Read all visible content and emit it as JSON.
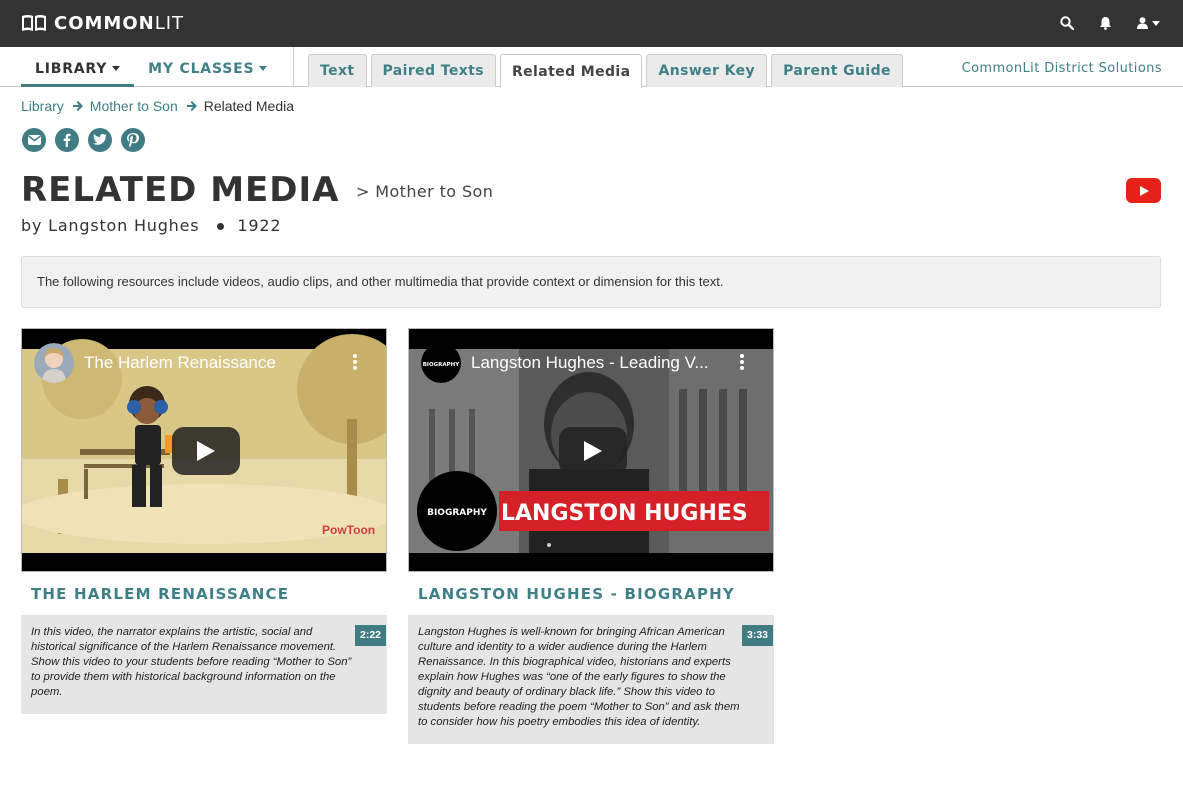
{
  "brand": {
    "name_bold": "COMMON",
    "name_light": "LIT"
  },
  "topbar": {
    "icons": [
      "search-icon",
      "bell-icon",
      "user-icon"
    ]
  },
  "nav": {
    "library": "LIBRARY",
    "my_classes": "MY CLASSES",
    "tabs": [
      "Text",
      "Paired Texts",
      "Related Media",
      "Answer Key",
      "Parent Guide"
    ],
    "active_tab": "Related Media",
    "district": "CommonLit District Solutions"
  },
  "breadcrumb": {
    "items": [
      "Library",
      "Mother to Son",
      "Related Media"
    ]
  },
  "share": {
    "icons": [
      "email-icon",
      "facebook-icon",
      "twitter-icon",
      "pinterest-icon"
    ]
  },
  "page": {
    "title": "RELATED MEDIA",
    "subtitle": "> Mother to Son",
    "author": "by Langston Hughes",
    "year": "1922",
    "note": "The following resources include videos, audio clips, and other multimedia that provide context or dimension for this text."
  },
  "media": [
    {
      "video_title": "The Harlem Renaissance",
      "card_title": "THE HARLEM RENAISSANCE",
      "duration": "2:22",
      "description": "In this video, the narrator explains the artistic, social and historical significance of the Harlem Renaissance movement. Show this video to your students before reading “Mother to Son” to provide them with historical background information on the poem.",
      "watermark": "PowToon"
    },
    {
      "video_title": "Langston Hughes - Leading V...",
      "card_title": "LANGSTON HUGHES - BIOGRAPHY",
      "duration": "3:33",
      "description": "Langston Hughes is well-known for bringing African American culture and identity to a wider audience during the Harlem Renaissance. In this biographical video, historians and experts explain how Hughes was “one of the early figures to show the dignity and beauty of ordinary black life.” Show this video to students before reading the poem “Mother to Son” and ask them to consider how his poetry embodies this idea of identity.",
      "channel_logo": "BIOGRAPHY",
      "banner_text": "LANGSTON HUGHES"
    }
  ],
  "colors": {
    "accent": "#3f8088",
    "topbar": "#333333",
    "youtube": "#e62117"
  }
}
